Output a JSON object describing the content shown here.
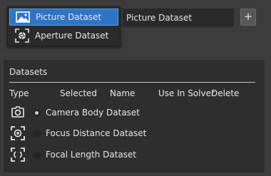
{
  "dropdown": {
    "items": [
      {
        "label": "Picture Dataset",
        "icon": "picture-icon",
        "selected": true
      },
      {
        "label": "Aperture Dataset",
        "icon": "aperture-icon",
        "selected": false
      }
    ]
  },
  "name_input": {
    "value": "Picture Dataset"
  },
  "add_button": {
    "label": "+"
  },
  "datasets": {
    "title": "Datasets",
    "columns": [
      "Type",
      "Selected",
      "Name",
      "Use In Solver",
      "Delete"
    ],
    "rows": [
      {
        "label": "Camera Body Dataset",
        "icon": "camera-body-icon",
        "selected": true
      },
      {
        "label": "Focus Distance Dataset",
        "icon": "focus-distance-icon",
        "selected": false
      },
      {
        "label": "Focal Length Dataset",
        "icon": "focal-length-icon",
        "selected": false
      }
    ]
  },
  "colors": {
    "background": "#3c3c3c",
    "panel": "#2e2e2e",
    "selection": "#2f73c4"
  }
}
